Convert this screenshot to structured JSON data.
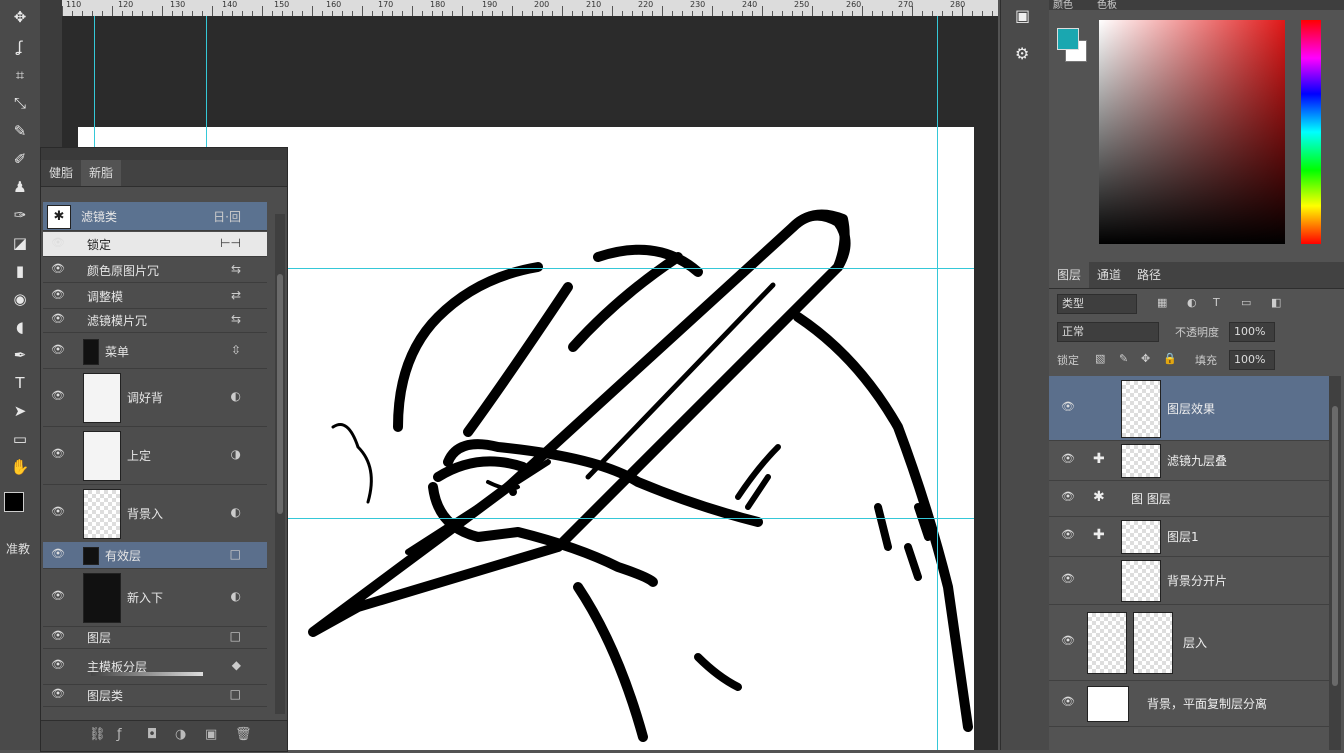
{
  "toolbar": {
    "tools": [
      "move-icon",
      "lasso-icon",
      "crop-icon",
      "eyedropper-icon",
      "healing-icon",
      "brush-icon",
      "stamp-icon",
      "history-brush-icon",
      "eraser-icon",
      "gradient-icon",
      "blur-icon",
      "dodge-icon",
      "pen-icon",
      "type-icon",
      "path-select-icon",
      "shape-icon",
      "hand-icon",
      "zoom-icon"
    ],
    "label": "准教"
  },
  "ruler": {
    "numbers": [
      "110",
      "120",
      "130",
      "140",
      "150",
      "160",
      "170",
      "180",
      "190",
      "200",
      "210",
      "220",
      "230",
      "240",
      "250",
      "260",
      "270",
      "280"
    ]
  },
  "left_panel": {
    "tabs": [
      "健脂",
      "新脂"
    ],
    "rows": [
      {
        "name": "滤镜类",
        "right": "日·回"
      },
      {
        "name": "锁定",
        "right": "⊢⊣"
      },
      {
        "name": "颜色原图片冗",
        "right": "⇆"
      },
      {
        "name": "调整模",
        "right": "⇄"
      },
      {
        "name": "滤镜模片冗",
        "right": "⇆"
      },
      {
        "name": "菜单",
        "right": "⇳"
      },
      {
        "name": "调好背",
        "right": "◐"
      },
      {
        "name": "上定",
        "right": "◑"
      },
      {
        "name": "背景入",
        "right": "◐"
      },
      {
        "name": "有效层",
        "right": "□"
      },
      {
        "name": "新入下",
        "right": "◐"
      },
      {
        "name": "图层",
        "right": "□"
      },
      {
        "name": "主模板分层",
        "right": "◆"
      },
      {
        "name": "图层类",
        "right": "□"
      }
    ],
    "bottom_icons": [
      "link-icon",
      "fx-icon",
      "mask-icon",
      "adjust-icon",
      "folder-icon",
      "delete-icon"
    ]
  },
  "mid_panel": {
    "icons": [
      "history-icon",
      "actions-icon"
    ]
  },
  "right_panel": {
    "color_tab": "颜色",
    "color_tab2": "色板",
    "colors": {
      "foreground": "#1aa7b0",
      "background": "#ffffff"
    },
    "layer_tabs": [
      "图层",
      "通道",
      "路径"
    ],
    "kind": "类型",
    "mode": "正常",
    "opacity_label": "不透明度",
    "opacity": "100%",
    "lock_label": "锁定",
    "fill_label": "填充",
    "fill": "100%",
    "layers": [
      {
        "name": "图层效果"
      },
      {
        "name": "滤镜九层叠"
      },
      {
        "name": "图 图层"
      },
      {
        "name": "图层1"
      },
      {
        "name": "背景分开片"
      },
      {
        "name": "层入"
      },
      {
        "name": "背景，平面复制层分离"
      }
    ]
  }
}
